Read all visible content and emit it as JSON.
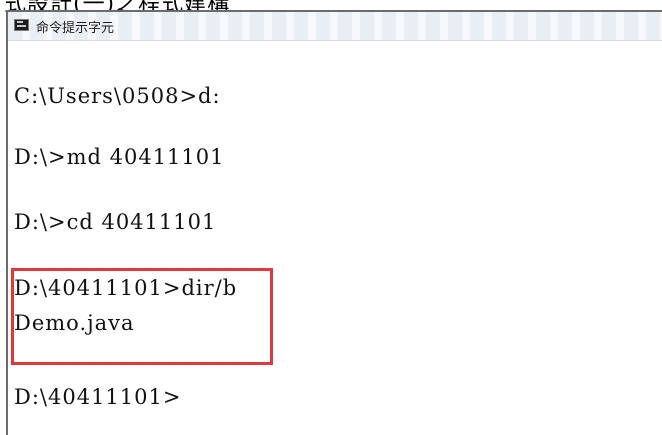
{
  "document": {
    "caption": "式設計(一)之程式建構"
  },
  "window": {
    "title": "命令提示字元",
    "icon": "cmd-icon"
  },
  "console": {
    "lines": [
      "C:\\Users\\0508>d:",
      "D:\\>md 40411101",
      "D:\\>cd 40411101",
      "D:\\40411101>dir/b",
      "Demo.java",
      "D:\\40411101>"
    ]
  },
  "annotation": {
    "highlight_color": "#e0383f"
  }
}
